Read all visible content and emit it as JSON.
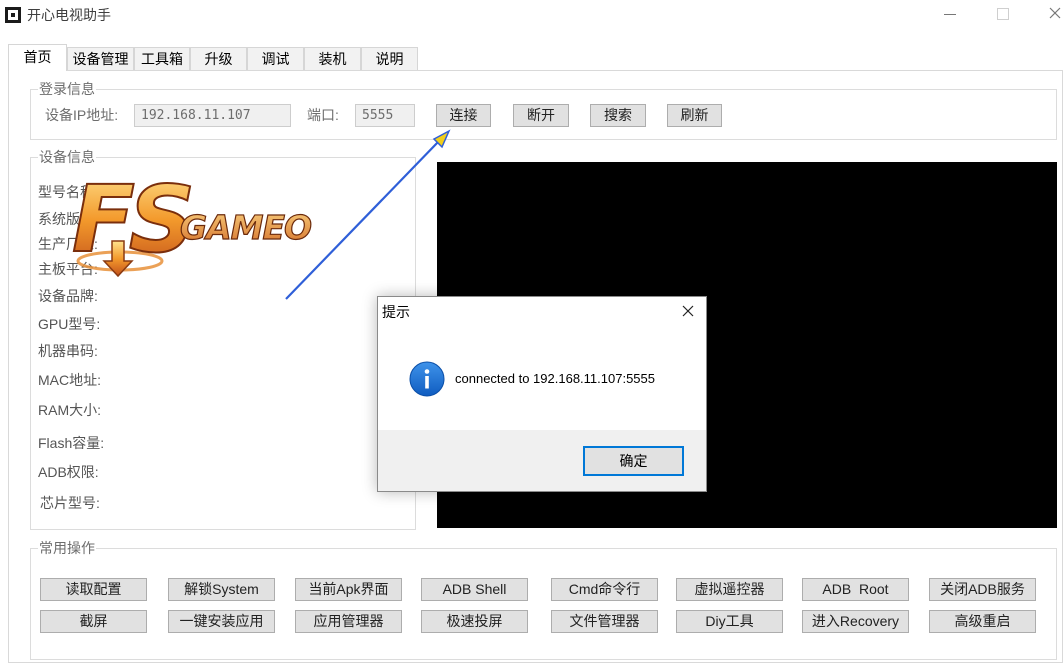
{
  "window": {
    "title": "开心电视助手",
    "app_icon": "app-window-icon",
    "controls": [
      "minimize-icon",
      "maximize-icon",
      "close-icon"
    ]
  },
  "tabs": [
    {
      "label": "首页",
      "selected": true
    },
    {
      "label": "设备管理"
    },
    {
      "label": "工具箱"
    },
    {
      "label": "升级"
    },
    {
      "label": "调试"
    },
    {
      "label": "装机"
    },
    {
      "label": "说明"
    }
  ],
  "login": {
    "legend": "登录信息",
    "ip_label": "设备IP地址:",
    "ip_value": "192.168.11.107",
    "port_label": "端口:",
    "port_value": "5555",
    "buttons": [
      "连接",
      "断开",
      "搜索",
      "刷新"
    ]
  },
  "device_info": {
    "legend": "设备信息",
    "fields": [
      "型号名称:",
      "系统版本:",
      "生产厂家:",
      "主板平台:",
      "设备品牌:",
      "GPU型号:",
      "机器串码:",
      "MAC地址:",
      "RAM大小:",
      "Flash容量:",
      "ADB权限:",
      "芯片型号:"
    ]
  },
  "operations": {
    "legend": "常用操作",
    "row1": [
      "读取配置",
      "解锁System",
      "当前Apk界面",
      "ADB Shell",
      "Cmd命令行",
      "虚拟遥控器",
      "ADB  Root",
      "关闭ADB服务"
    ],
    "row2": [
      "截屏",
      "一键安装应用",
      "应用管理器",
      "极速投屏",
      "文件管理器",
      "Diy工具",
      "进入Recovery",
      "高级重启"
    ]
  },
  "dialog": {
    "title": "提示",
    "icon": "info-icon",
    "message": "connected to 192.168.11.107:5555",
    "ok_label": "确定",
    "close_icon": "close-icon"
  },
  "watermark": {
    "mark": "FS",
    "word": "GAMEO"
  },
  "colors": {
    "accent": "#0078d7",
    "info_blue": "#1b6fd6",
    "button_face": "#e1e1e1",
    "preview": "#000000",
    "annotation_arrow": "#2f5fd8"
  }
}
